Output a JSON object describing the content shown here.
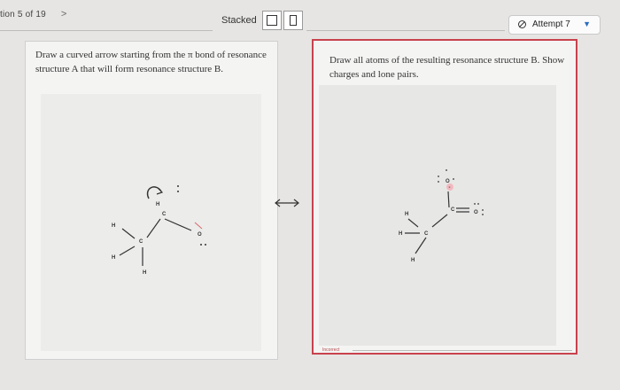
{
  "nav": {
    "question_label": "tion 5 of 19",
    "next_chevron": ">"
  },
  "toolbar": {
    "stacked_label": "Stacked",
    "view_stacked_icon": "square-icon",
    "view_split_icon": "split-icon"
  },
  "attempt": {
    "label": "Attempt 7",
    "icon": "ban-icon",
    "caret": "▼",
    "accent_color": "#2a6fbd"
  },
  "left_panel": {
    "prompt": "Draw a curved arrow starting from the π bond of resonance structure A that will form resonance structure B.",
    "molecule": {
      "atoms": [
        "H",
        "C",
        "H",
        "H",
        "C",
        "H",
        "O",
        "H"
      ]
    }
  },
  "right_panel": {
    "prompt": "Draw all atoms of the resulting resonance structure B. Show charges and lone pairs.",
    "status": "Incorrect",
    "border_color": "#c7424d",
    "molecule": {
      "atoms": [
        "O",
        "C",
        "O",
        "H",
        "C",
        "H",
        "H"
      ],
      "charge_symbol": "-"
    }
  },
  "resonance_arrow": "↔"
}
